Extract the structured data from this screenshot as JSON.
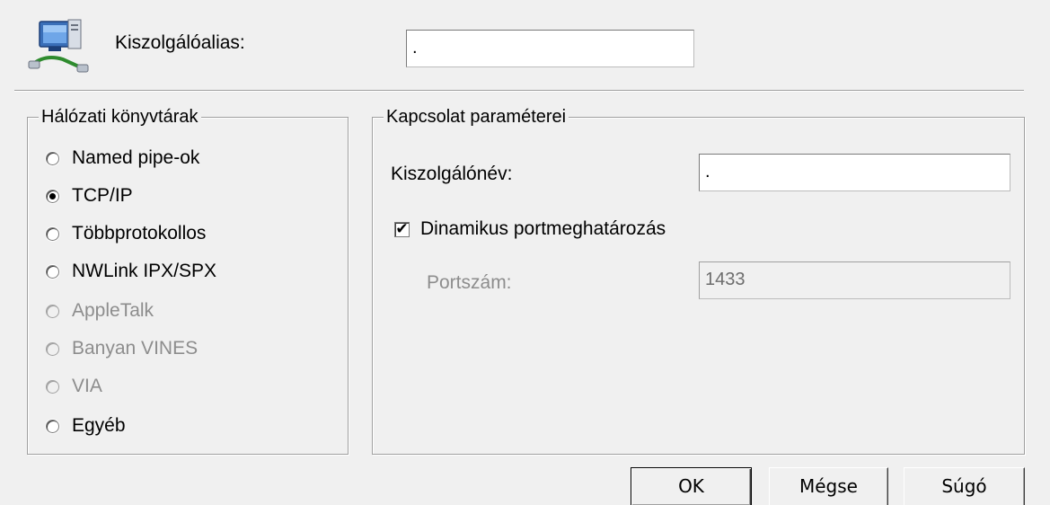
{
  "alias": {
    "icon": "network-computer-icon",
    "label": "Kiszolgálóalias:",
    "value": "."
  },
  "libraries": {
    "legend": "Hálózati könyvtárak",
    "options": [
      {
        "label": "Named pipe-ok",
        "checked": false,
        "disabled": false
      },
      {
        "label": "TCP/IP",
        "checked": true,
        "disabled": false
      },
      {
        "label": "Többprotokollos",
        "checked": false,
        "disabled": false
      },
      {
        "label": "NWLink IPX/SPX",
        "checked": false,
        "disabled": false
      },
      {
        "label": "AppleTalk",
        "checked": false,
        "disabled": true
      },
      {
        "label": "Banyan VINES",
        "checked": false,
        "disabled": true
      },
      {
        "label": "VIA",
        "checked": false,
        "disabled": true
      },
      {
        "label": "Egyéb",
        "checked": false,
        "disabled": false
      }
    ]
  },
  "connection": {
    "legend": "Kapcsolat paraméterei",
    "server_name_label": "Kiszolgálónév:",
    "server_name_value": ".",
    "dynamic_port_label": "Dinamikus portmeghatározás",
    "dynamic_port_checked": true,
    "port_label": "Portszám:",
    "port_value": "1433"
  },
  "buttons": {
    "ok": "OK",
    "cancel": "Mégse",
    "help": "Súgó"
  }
}
